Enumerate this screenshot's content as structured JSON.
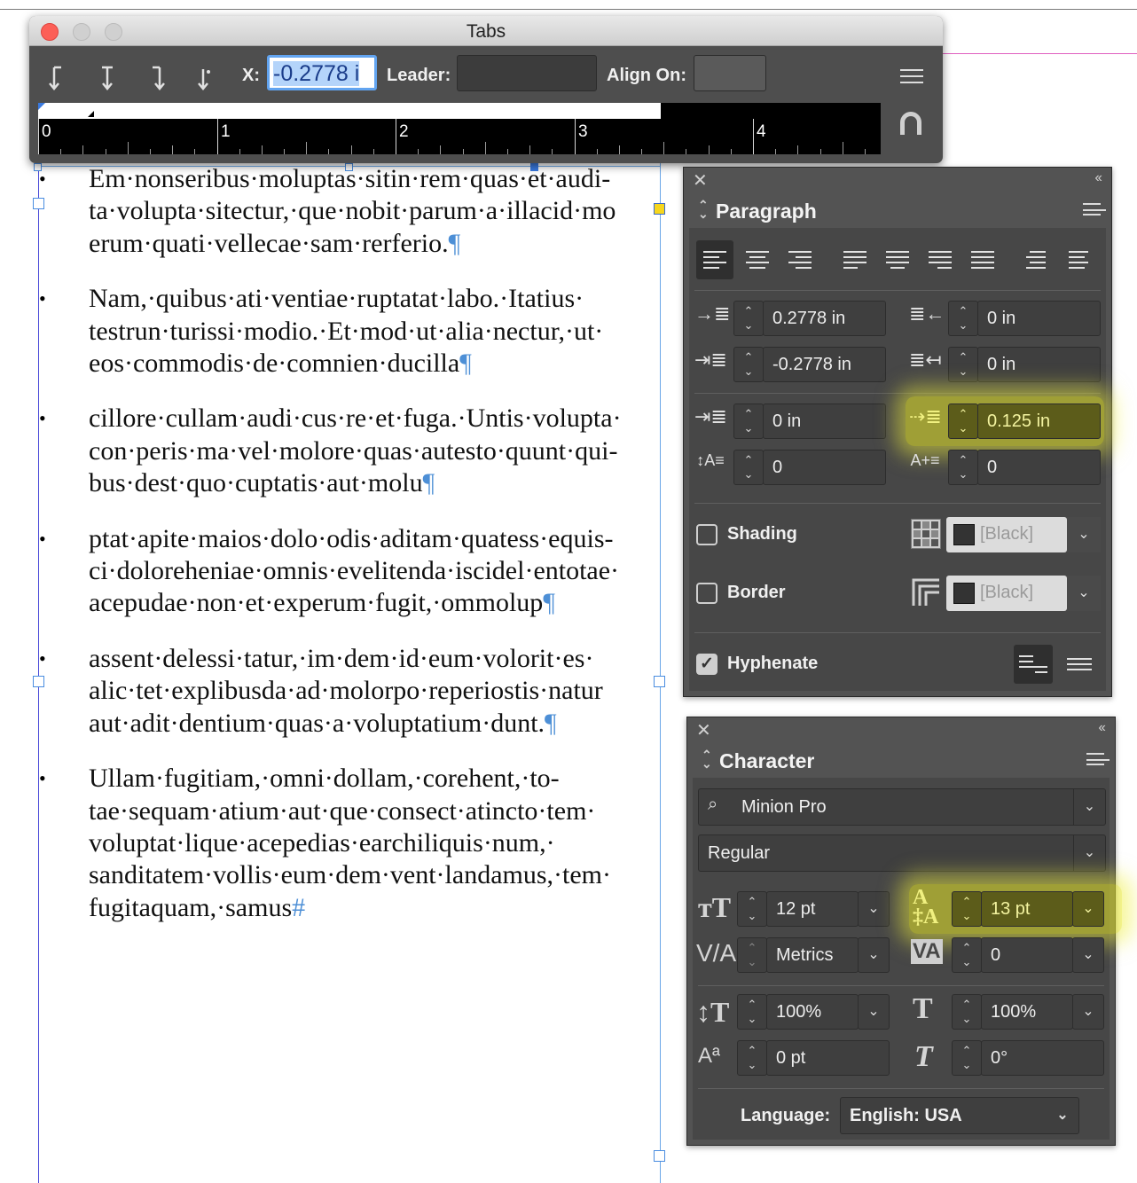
{
  "document": {
    "paragraphs": [
      {
        "text": "Em·nonseribus·moluptas·sitin·rem·quas·et·audi-\nta·volupta·sitectur,·que·nobit·parum·a·illacid·mo\nerum·quati·vellecae·sam·rerferio.",
        "end": "¶"
      },
      {
        "text": "Nam,·quibus·ati·ventiae·ruptatat·labo.·Itatius·\ntestrun·turissi·modio.·Et·mod·ut·alia·nectur,·ut·\neos·commodis·de·comnien·ducilla",
        "end": "¶"
      },
      {
        "text": "cillore·cullam·audi·cus·re·et·fuga.·Untis·volupta·\ncon·peris·ma·vel·molore·quas·autesto·quunt·qui-\nbus·dest·quo·cuptatis·aut·molu",
        "end": "¶"
      },
      {
        "text": "ptat·apite·maios·dolo·odis·aditam·quatess·equis-\nci·dolorehen­iae·omnis·evelitenda·iscidel·entotae·\nacepudae·non·et·experum·fugit,·ommolup",
        "end": "¶"
      },
      {
        "text": "assent·delessi·tatur,·im·dem·id·eum·volorit·es·\nalic·tet·explibusda·ad·molorpo·reperiostis·natur\naut·adit·dentium·quas·a·voluptatium·dunt.",
        "end": "¶"
      },
      {
        "text": "Ullam·fugitiam,·omni·dollam,·corehent,·to-\ntae·sequam·atium·aut·que·consect·atincto·tem·\nvoluptat·lique·acepedias·earchiliquis·num,·\nsanditatem·vollis·eum·dem·vent·landamus,·tem·\nfugitaquam,·samus",
        "end": "#"
      }
    ],
    "bullet": "•"
  },
  "tabs_panel": {
    "title": "Tabs",
    "x_label": "X:",
    "x_value": "-0.2778 i",
    "leader_label": "Leader:",
    "leader_value": "",
    "align_on_label": "Align On:",
    "align_on_value": "",
    "ruler_numbers": [
      "0",
      "1",
      "2",
      "3",
      "4"
    ],
    "tab_types": [
      "left-justified-tab-icon",
      "center-justified-tab-icon",
      "right-justified-tab-icon",
      "align-to-decimal-tab-icon"
    ]
  },
  "paragraph_panel": {
    "title": "Paragraph",
    "left_indent": "0.2778 in",
    "right_indent": "0 in",
    "first_line_indent": "-0.2778 in",
    "last_line_right_indent": "0 in",
    "space_before": "0 in",
    "space_after": "0.125 in",
    "drop_cap_lines": "0",
    "drop_cap_chars": "0",
    "shading_label": "Shading",
    "shading_color": "[Black]",
    "shading_checked": false,
    "border_label": "Border",
    "border_color": "[Black]",
    "border_checked": false,
    "hyphenate_label": "Hyphenate",
    "hyphenate_checked": true,
    "drop_cap_lines_icon": "↕A≡",
    "drop_cap_chars_icon": "A+≡"
  },
  "character_panel": {
    "title": "Character",
    "font_family": "Minion Pro",
    "font_style": "Regular",
    "font_size": "12 pt",
    "leading": "13 pt",
    "kerning": "Metrics",
    "tracking": "0",
    "vertical_scale": "100%",
    "horizontal_scale": "100%",
    "baseline_shift": "0 pt",
    "skew": "0°",
    "language_label": "Language:",
    "language": "English: USA"
  },
  "colors": {
    "panel_bg": "#535353",
    "highlight": "#e8e828",
    "pilcrow": "#4d8fd6"
  }
}
